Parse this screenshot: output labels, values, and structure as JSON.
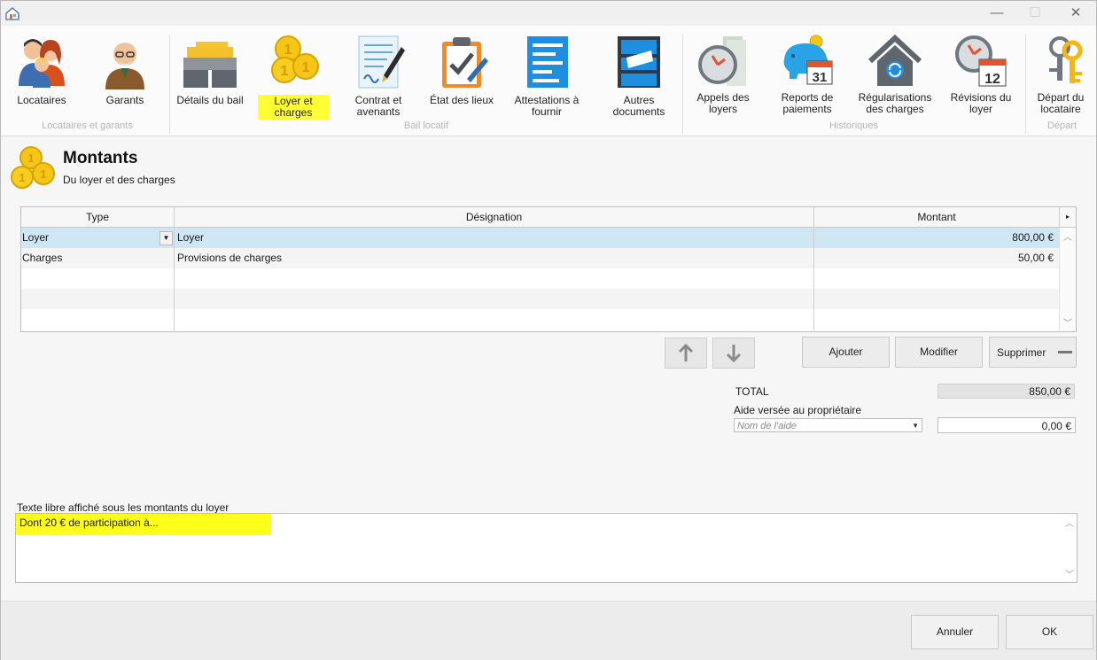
{
  "ribbon": {
    "items": [
      {
        "label": "Locataires"
      },
      {
        "label": "Garants"
      },
      {
        "label": "Détails du bail"
      },
      {
        "label_line1": "Loyer et",
        "label_line2": "charges"
      },
      {
        "label_line1": "Contrat et",
        "label_line2": "avenants"
      },
      {
        "label": "État des lieux"
      },
      {
        "label_line1": "Attestations à",
        "label_line2": "fournir"
      },
      {
        "label_line1": "Autres",
        "label_line2": "documents"
      },
      {
        "label_line1": "Appels des",
        "label_line2": "loyers"
      },
      {
        "label_line1": "Reports de",
        "label_line2": "paiements"
      },
      {
        "label_line1": "Régularisations",
        "label_line2": "des charges"
      },
      {
        "label_line1": "Révisions du",
        "label_line2": "loyer"
      },
      {
        "label_line1": "Départ du",
        "label_line2": "locataire"
      }
    ],
    "groups": {
      "g1": "Locataires et garants",
      "g2": "Bail locatif",
      "g3": "Historiques",
      "g4": "Départ"
    },
    "calendar_day": "31",
    "clock_calendar_day": "12"
  },
  "page": {
    "title": "Montants",
    "subtitle": "Du loyer et des charges"
  },
  "grid": {
    "headers": {
      "type": "Type",
      "designation": "Désignation",
      "montant": "Montant"
    },
    "rows": [
      {
        "type": "Loyer",
        "designation": "Loyer",
        "montant": "800,00 €"
      },
      {
        "type": "Charges",
        "designation": "Provisions de charges",
        "montant": "50,00 €"
      }
    ]
  },
  "actions": {
    "add": "Ajouter",
    "edit": "Modifier",
    "delete": "Supprimer"
  },
  "totals": {
    "total_label": "TOTAL",
    "total_value": "850,00 €",
    "aide_label": "Aide versée au propriétaire",
    "aide_placeholder": "Nom de l'aide",
    "aide_value": "0,00 €"
  },
  "free_text": {
    "label": "Texte libre affiché sous les montants du loyer",
    "value": "Dont 20 € de participation à..."
  },
  "footer": {
    "cancel": "Annuler",
    "ok": "OK"
  },
  "colors": {
    "highlight": "#ffff33",
    "selected_row": "#cfe6f5"
  }
}
